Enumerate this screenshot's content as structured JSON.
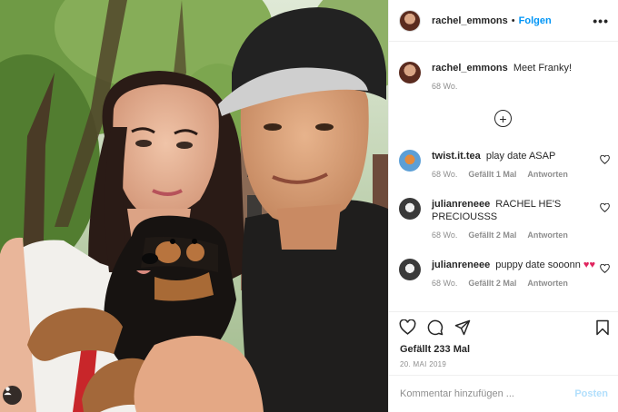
{
  "post": {
    "username": "rachel_emmons",
    "follow_label": "Folgen",
    "separator": "•",
    "more_label": "•••",
    "caption": {
      "username": "rachel_emmons",
      "text": "Meet Franky!",
      "time": "68 Wo."
    },
    "load_more_symbol": "+",
    "comments": [
      {
        "username": "twist.it.tea",
        "text": "play date ASAP",
        "time": "68 Wo.",
        "likes": "Gefällt 1 Mal",
        "reply": "Antworten",
        "avatar_color": "#5c9fd6"
      },
      {
        "username": "julianreneee",
        "text": "RACHEL HE'S PRECIOUSSS",
        "time": "68 Wo.",
        "likes": "Gefällt 2 Mal",
        "reply": "Antworten",
        "avatar_color": "#3a3a3a"
      },
      {
        "username": "julianreneee",
        "text": "puppy date sooonn",
        "hearts": "♥♥",
        "time": "68 Wo.",
        "likes": "Gefällt 2 Mal",
        "reply": "Antworten",
        "avatar_color": "#3a3a3a"
      }
    ],
    "likes_text": "Gefällt 233 Mal",
    "date_text": "20. MAI 2019",
    "comment_placeholder": "Kommentar hinzufügen ...",
    "post_label": "Posten"
  },
  "colors": {
    "follow": "#0095f6",
    "muted": "#8e8e8e",
    "post_disabled": "#b2dffc",
    "heart_emoji": "#e0245e"
  },
  "icons": [
    "heart-icon",
    "comment-icon",
    "share-icon",
    "bookmark-icon",
    "user-tag-icon",
    "plus-circle-icon",
    "more-icon"
  ]
}
